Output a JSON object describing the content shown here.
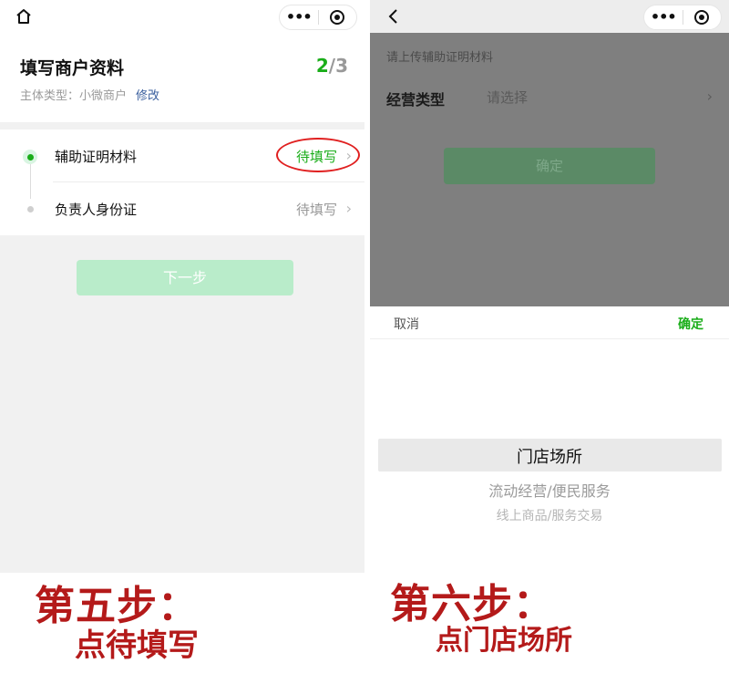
{
  "left": {
    "header": {
      "title": "填写商户资料",
      "step_current": "2",
      "step_total": "/3",
      "subject_label": "主体类型：小微商户",
      "modify_link": "修改"
    },
    "steps": [
      {
        "label": "辅助证明材料",
        "status": "待填写",
        "active": true
      },
      {
        "label": "负责人身份证",
        "status": "待填写",
        "active": false
      }
    ],
    "next_button": "下一步",
    "caption_title": "第五步：",
    "caption_sub": "点待填写"
  },
  "right": {
    "upload_hint": "请上传辅助证明材料",
    "biz_type_label": "经营类型",
    "biz_type_placeholder": "请选择",
    "confirm_button": "确定",
    "sheet": {
      "cancel": "取消",
      "ok": "确定",
      "options": [
        "门店场所",
        "流动经营/便民服务",
        "线上商品/服务交易"
      ],
      "selected": "门店场所"
    },
    "caption_title": "第六步：",
    "caption_sub": "点门店场所"
  },
  "colors": {
    "accent": "#1aad19",
    "annotation_red": "#b41a1a"
  },
  "icons": {
    "home": "home-icon",
    "back": "back-chevron-icon",
    "more": "more-dots-icon",
    "target": "target-circle-icon"
  }
}
